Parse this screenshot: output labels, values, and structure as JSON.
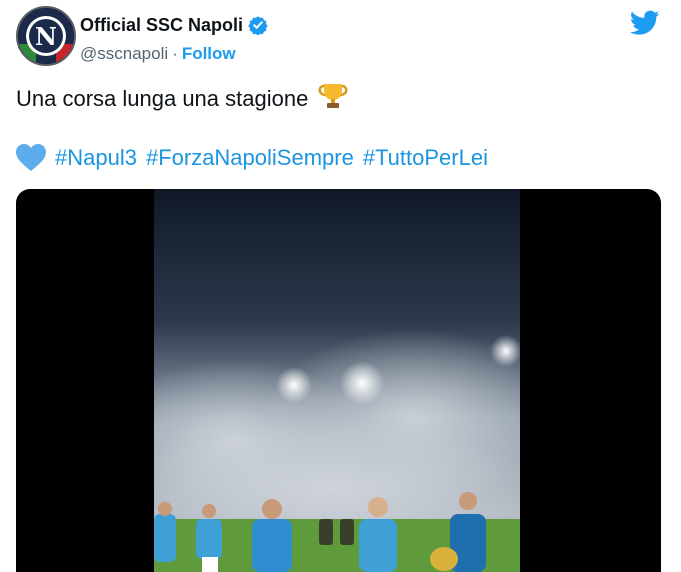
{
  "tweet": {
    "account": {
      "display_name": "Official SSC Napoli",
      "handle": "@sscnapoli",
      "separator": "·",
      "follow_label": "Follow",
      "avatar_letter": "N",
      "verified": true
    },
    "text": "Una corsa lunga una stagione",
    "text_emoji": "trophy-icon",
    "hashtag_emoji": "blue-heart-icon",
    "hashtags": [
      "#Napul3",
      "#ForzaNapoliSempre",
      "#TuttoPerLei"
    ],
    "media": {
      "type": "video",
      "scene": "stadium-celebration"
    }
  },
  "colors": {
    "link": "#1b95e0",
    "twitter_blue": "#1d9bf0",
    "text": "#0f1419",
    "secondary": "#536471",
    "avatar_bg": "#1c2b4a",
    "pitch": "#5f9a3c",
    "jersey": "#3fa0d6"
  }
}
